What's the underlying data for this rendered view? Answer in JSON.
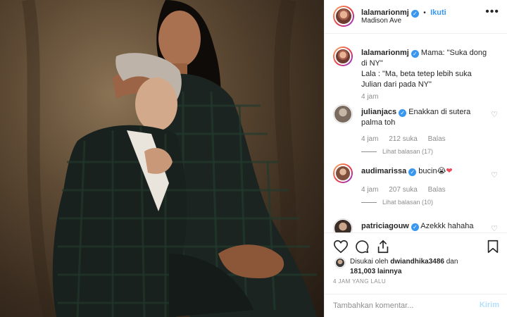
{
  "post": {
    "username": "lalamarionmj",
    "follow_dot": "•",
    "follow_label": "Ikuti",
    "location": "Madison Ave",
    "more_icon": "more-horizontal-icon"
  },
  "caption": {
    "username": "lalamarionmj",
    "text_line1": "Mama: \"Suka dong di NY\"",
    "text_line2": "Lala : \"Ma, beta tetep lebih suka Julian dari pada NY\"",
    "time": "4 jam"
  },
  "comments": [
    {
      "username": "julianjacs",
      "text": "Enakkan di sutera palma toh",
      "time": "4 jam",
      "likes": "212 suka",
      "reply": "Balas",
      "view_replies": "Lihat balasan (17)"
    },
    {
      "username": "audimarissa",
      "text": "bucin",
      "emoji": "😭",
      "heart": "❤",
      "time": "4 jam",
      "likes": "207 suka",
      "reply": "Balas",
      "view_replies": "Lihat balasan (10)"
    },
    {
      "username": "patriciagouw",
      "text": "Azekkk hahaha"
    }
  ],
  "actions": {
    "like_icon": "heart-icon",
    "comment_icon": "comment-icon",
    "share_icon": "share-icon",
    "save_icon": "bookmark-icon"
  },
  "likes": {
    "prefix": "Disukai oleh",
    "user": "dwiandhika3486",
    "conj": "dan",
    "count": "181,003",
    "suffix": "lainnya"
  },
  "timestamp": "4 JAM YANG LALU",
  "add_comment": {
    "placeholder": "Tambahkan komentar...",
    "send_label": "Kirim"
  },
  "colors": {
    "accent": "#3897f0",
    "send_disabled": "#b2dffc",
    "heart_red": "#ed4956"
  }
}
